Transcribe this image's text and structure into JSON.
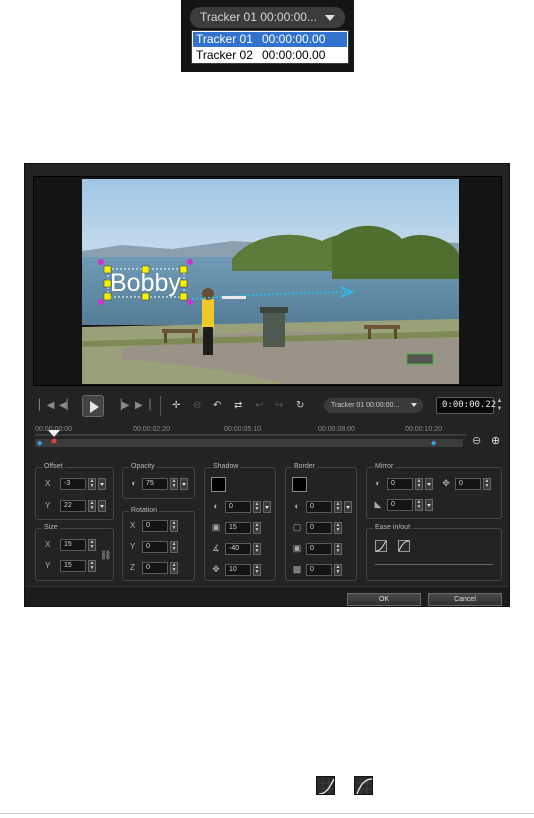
{
  "dropdown_callout": {
    "selected_label": "Tracker 01   00:00:00...",
    "options": [
      {
        "name": "Tracker 01",
        "time": "00:00:00.00",
        "selected": true
      },
      {
        "name": "Tracker 02",
        "time": "00:00:00.00",
        "selected": false
      }
    ]
  },
  "video": {
    "overlay_text": "Bobby"
  },
  "transport": {
    "tracker_label": "Tracker 01  00:00:00...",
    "timecode": "0:00:00.22"
  },
  "ruler": {
    "labels": [
      "00:00:00:00",
      "00:00:02:20",
      "00:00:05:10",
      "00:00:08:00",
      "00:00:10:20"
    ]
  },
  "offset": {
    "title": "Offset",
    "x_label": "X",
    "x": "-3",
    "y_label": "Y",
    "y": "22"
  },
  "size": {
    "title": "Size",
    "x_label": "X",
    "x": "15",
    "y_label": "Y",
    "y": "15"
  },
  "opacity": {
    "title": "Opacity",
    "value": "75"
  },
  "rotation": {
    "title": "Rotation",
    "x_label": "X",
    "x": "0",
    "y_label": "Y",
    "y": "0",
    "z_label": "Z",
    "z": "0"
  },
  "shadow": {
    "title": "Shadow",
    "v1": "0",
    "v2": "15",
    "v3": "-40",
    "v4": "10"
  },
  "border": {
    "title": "Border",
    "v1": "0",
    "v2": "0",
    "v3": "0",
    "v4": "0"
  },
  "mirror": {
    "title": "Mirror",
    "v1": "0",
    "v2": "0",
    "v3": "0"
  },
  "ease": {
    "title": "Ease in/out"
  },
  "buttons": {
    "ok": "OK",
    "cancel": "Cancel"
  },
  "colors": {
    "dialog_bg": "#232323",
    "selection": "#3173cc",
    "accent_keyframe": "#3aa0e8"
  }
}
